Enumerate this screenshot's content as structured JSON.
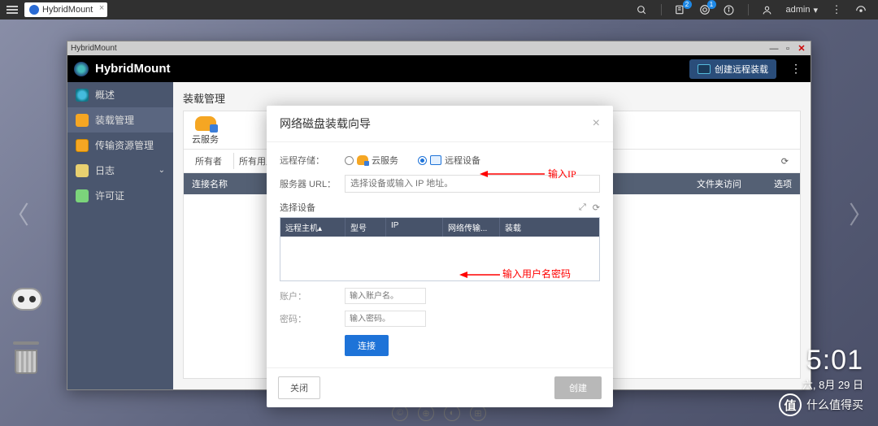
{
  "topbar": {
    "tab_label": "HybridMount",
    "notif_count": "2",
    "alert_count": "1",
    "user": "admin",
    "user_caret": "▾"
  },
  "window": {
    "title": "HybridMount",
    "app_name": "HybridMount",
    "cta_button": "创建远程装载"
  },
  "sidebar": {
    "items": [
      {
        "label": "概述"
      },
      {
        "label": "装载管理"
      },
      {
        "label": "传输资源管理"
      },
      {
        "label": "日志"
      },
      {
        "label": "许可证"
      }
    ]
  },
  "main": {
    "title": "装载管理",
    "tab_cloud": "云服务",
    "filter_owner": "所有者",
    "filter_owner_val": "所有用户",
    "col_name": "连接名称",
    "col_fs": "文件夹访问",
    "col_opt": "选项"
  },
  "modal": {
    "title": "网络磁盘装载向导",
    "row_mode": "远程存储：",
    "opt_cloud": "云服务",
    "opt_remote": "远程设备",
    "row_url": "服务器 URL：",
    "url_placeholder": "选择设备或输入 IP 地址。",
    "sub_select": "选择设备",
    "th_host": "远程主机",
    "th_caret": "▴",
    "th_model": "型号",
    "th_ip": "IP",
    "th_proto": "网络传输...",
    "th_account": "装载",
    "row_user": "账户：",
    "ph_user": "输入账户名。",
    "row_pass": "密码：",
    "ph_pass": "输入密码。",
    "btn_connect": "连接",
    "btn_close": "关闭",
    "btn_create": "创建"
  },
  "annot": {
    "ip": "输入IP",
    "cred": "输入用户名密码"
  },
  "clock": {
    "time": "5:01",
    "date": "六, 8月 29 日"
  },
  "watermark": {
    "glyph": "值",
    "text": "什么值得买"
  }
}
